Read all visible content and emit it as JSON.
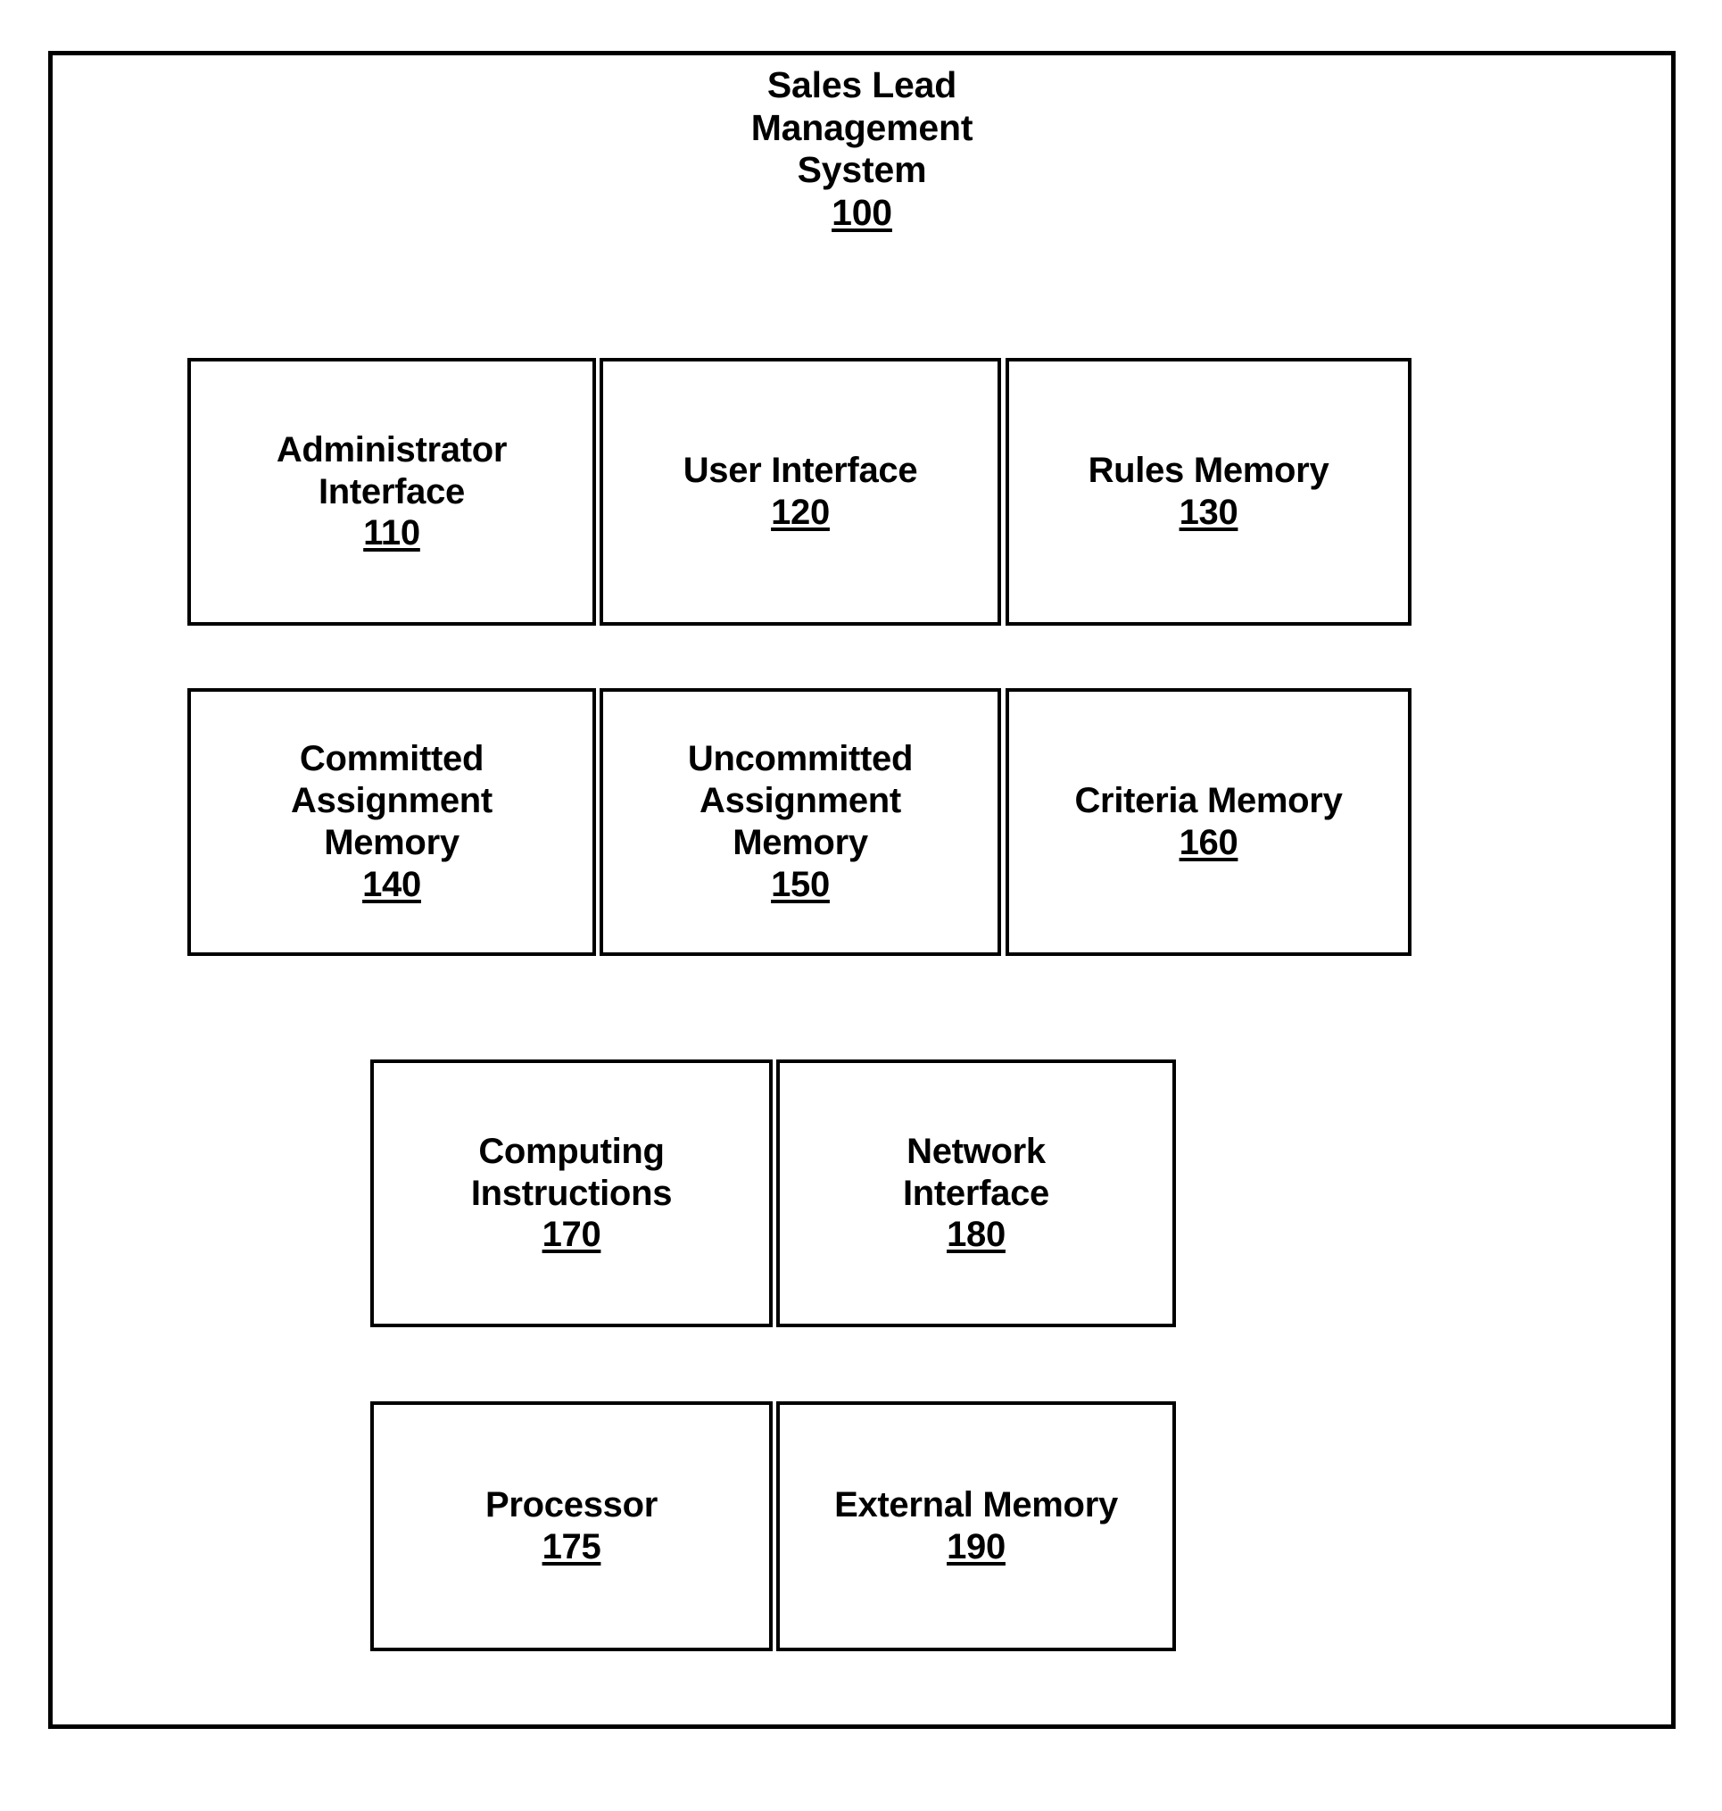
{
  "figure": {
    "system": {
      "title": "Sales Lead\nManagement\nSystem",
      "title_line1": "Sales Lead",
      "title_line2": "Management",
      "title_line3": "System",
      "reference_numeral": "100"
    },
    "components": [
      {
        "id": "110",
        "label": "Administrator\nInterface",
        "reference_numeral": "110",
        "row": 1,
        "column": 1
      },
      {
        "id": "120",
        "label": "User Interface",
        "reference_numeral": "120",
        "row": 1,
        "column": 2
      },
      {
        "id": "130",
        "label": "Rules Memory",
        "reference_numeral": "130",
        "row": 1,
        "column": 3
      },
      {
        "id": "140",
        "label": "Committed\nAssignment\nMemory",
        "reference_numeral": "140",
        "row": 2,
        "column": 1
      },
      {
        "id": "150",
        "label": "Uncommitted\nAssignment\nMemory",
        "reference_numeral": "150",
        "row": 2,
        "column": 2
      },
      {
        "id": "160",
        "label": "Criteria Memory",
        "reference_numeral": "160",
        "row": 2,
        "column": 3
      },
      {
        "id": "170",
        "label": "Computing\nInstructions",
        "reference_numeral": "170",
        "row": 3,
        "column": 1
      },
      {
        "id": "180",
        "label": "Network\nInterface",
        "reference_numeral": "180",
        "row": 3,
        "column": 2
      },
      {
        "id": "175",
        "label": "Processor",
        "reference_numeral": "175",
        "row": 4,
        "column": 1
      },
      {
        "id": "190",
        "label": "External Memory",
        "reference_numeral": "190",
        "row": 4,
        "column": 2
      }
    ],
    "colors": {
      "background": "#ffffff",
      "line": "#000000",
      "text": "#000000"
    }
  }
}
